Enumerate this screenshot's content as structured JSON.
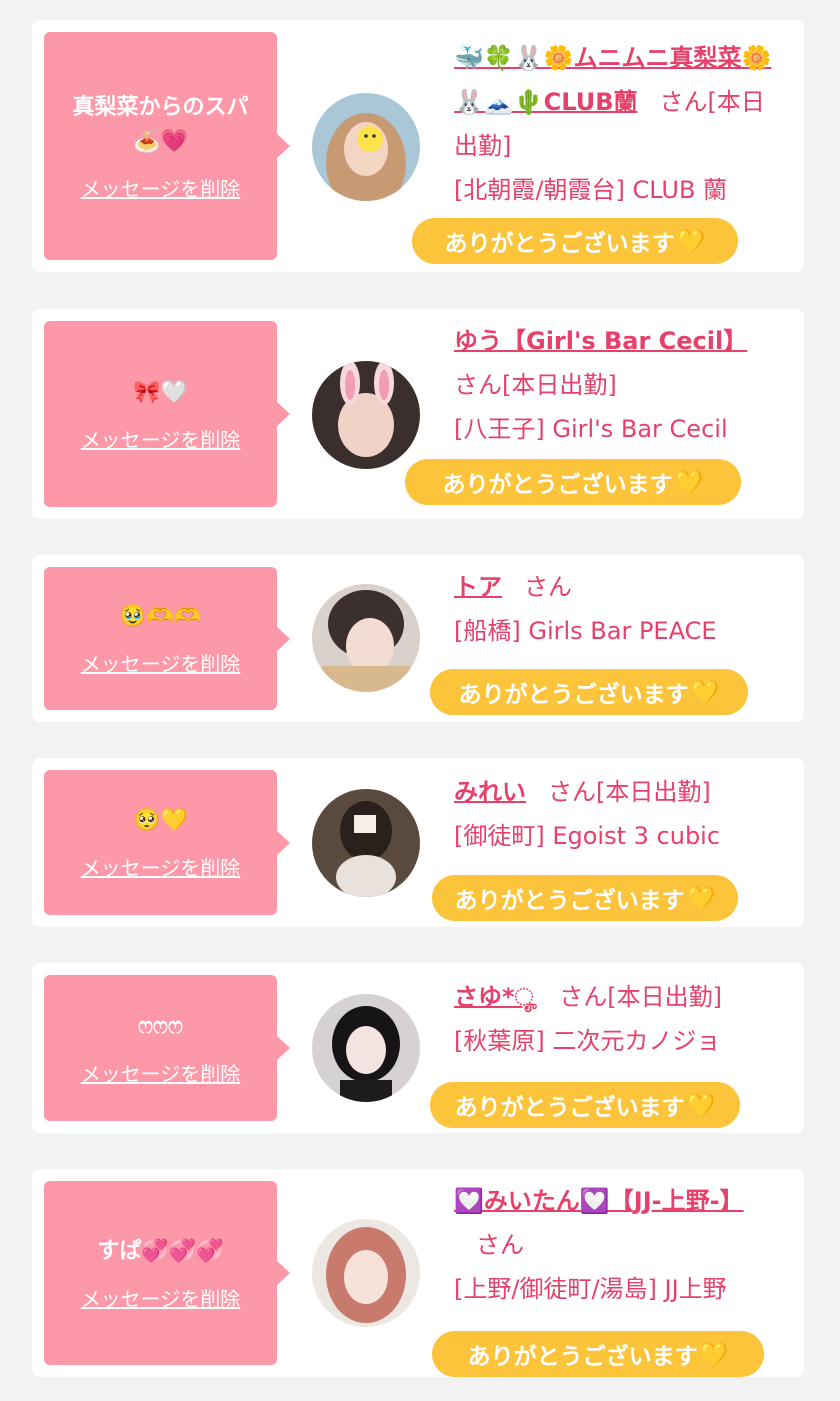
{
  "messages": [
    {
      "message": "真梨菜からのスパ🍝💗",
      "delete_label": "メッセージを削除",
      "cast_name": "🐳🍀🐰🌼ムニムニ真梨菜🌼🐰🗻🌵CLUB蘭",
      "honorific": "さん",
      "status": "[本日出勤]",
      "shop": "[北朝霞/朝霞台] CLUB 蘭",
      "thanks_label": "ありがとうございます",
      "heart": "💛"
    },
    {
      "message": "🎀🤍",
      "delete_label": "メッセージを削除",
      "cast_name": "ゆう【Girl's Bar Cecil】",
      "honorific": "さん",
      "status": "[本日出勤]",
      "shop": "[八王子] Girl's Bar Cecil",
      "thanks_label": "ありがとうございます",
      "heart": "💛"
    },
    {
      "message": "🥹🫶🫶",
      "delete_label": "メッセージを削除",
      "cast_name": "トア",
      "honorific": "さん",
      "status": "",
      "shop": "[船橋] Girls Bar PEACE",
      "thanks_label": "ありがとうございます",
      "heart": "💛"
    },
    {
      "message": "🥺💛",
      "delete_label": "メッセージを削除",
      "cast_name": "みれい",
      "honorific": "さん",
      "status": "[本日出勤]",
      "shop": "[御徒町] Egoist 3 cubic",
      "thanks_label": "ありがとうございます",
      "heart": "💛"
    },
    {
      "message": "ෆෆෆ",
      "delete_label": "メッセージを削除",
      "cast_name": "さゆ*ೄ",
      "honorific": "さん",
      "status": "[本日出勤]",
      "shop": "[秋葉原] 二次元カノジョ",
      "thanks_label": "ありがとうございます",
      "heart": "💛"
    },
    {
      "message": "すぱ💞💞💞",
      "delete_label": "メッセージを削除",
      "cast_name": "💟みいたん💟【JJ-上野-】",
      "honorific": "さん",
      "status": "",
      "shop": "[上野/御徒町/湯島] JJ上野",
      "thanks_label": "ありがとうございます",
      "heart": "💛"
    }
  ],
  "colors": {
    "background": "#f2f2f2",
    "bubble": "#fd98a8",
    "accent_text": "#e5416a",
    "thanks_button": "#fcc43b"
  }
}
